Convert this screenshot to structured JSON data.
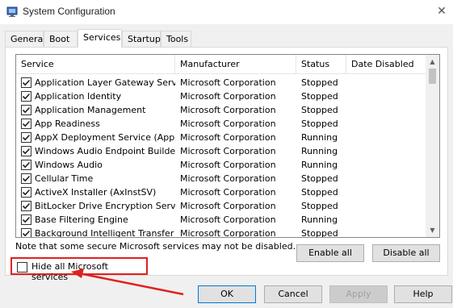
{
  "window": {
    "title": "System Configuration",
    "close_glyph": "✕"
  },
  "tabs": [
    {
      "label": "General",
      "active": false
    },
    {
      "label": "Boot",
      "active": false
    },
    {
      "label": "Services",
      "active": true
    },
    {
      "label": "Startup",
      "active": false
    },
    {
      "label": "Tools",
      "active": false
    }
  ],
  "list": {
    "columns": [
      "Service",
      "Manufacturer",
      "Status",
      "Date Disabled"
    ],
    "rows": [
      {
        "checked": true,
        "service": "Application Layer Gateway Service",
        "manufacturer": "Microsoft Corporation",
        "status": "Stopped",
        "date_disabled": ""
      },
      {
        "checked": true,
        "service": "Application Identity",
        "manufacturer": "Microsoft Corporation",
        "status": "Stopped",
        "date_disabled": ""
      },
      {
        "checked": true,
        "service": "Application Management",
        "manufacturer": "Microsoft Corporation",
        "status": "Stopped",
        "date_disabled": ""
      },
      {
        "checked": true,
        "service": "App Readiness",
        "manufacturer": "Microsoft Corporation",
        "status": "Stopped",
        "date_disabled": ""
      },
      {
        "checked": true,
        "service": "AppX Deployment Service (AppX...",
        "manufacturer": "Microsoft Corporation",
        "status": "Running",
        "date_disabled": ""
      },
      {
        "checked": true,
        "service": "Windows Audio Endpoint Builder",
        "manufacturer": "Microsoft Corporation",
        "status": "Running",
        "date_disabled": ""
      },
      {
        "checked": true,
        "service": "Windows Audio",
        "manufacturer": "Microsoft Corporation",
        "status": "Running",
        "date_disabled": ""
      },
      {
        "checked": true,
        "service": "Cellular Time",
        "manufacturer": "Microsoft Corporation",
        "status": "Stopped",
        "date_disabled": ""
      },
      {
        "checked": true,
        "service": "ActiveX Installer (AxInstSV)",
        "manufacturer": "Microsoft Corporation",
        "status": "Stopped",
        "date_disabled": ""
      },
      {
        "checked": true,
        "service": "BitLocker Drive Encryption Service",
        "manufacturer": "Microsoft Corporation",
        "status": "Stopped",
        "date_disabled": ""
      },
      {
        "checked": true,
        "service": "Base Filtering Engine",
        "manufacturer": "Microsoft Corporation",
        "status": "Running",
        "date_disabled": ""
      },
      {
        "checked": true,
        "service": "Background Intelligent Transfer ...",
        "manufacturer": "Microsoft Corporation",
        "status": "Stopped",
        "date_disabled": ""
      }
    ]
  },
  "note": "Note that some secure Microsoft services may not be disabled.",
  "buttons": {
    "enable_all": "Enable all",
    "disable_all": "Disable all",
    "ok": "OK",
    "cancel": "Cancel",
    "apply": "Apply",
    "help": "Help"
  },
  "hide_ms": {
    "label": "Hide all Microsoft services",
    "checked": false
  },
  "colors": {
    "highlight": "#e02020",
    "accent": "#0078d7"
  }
}
